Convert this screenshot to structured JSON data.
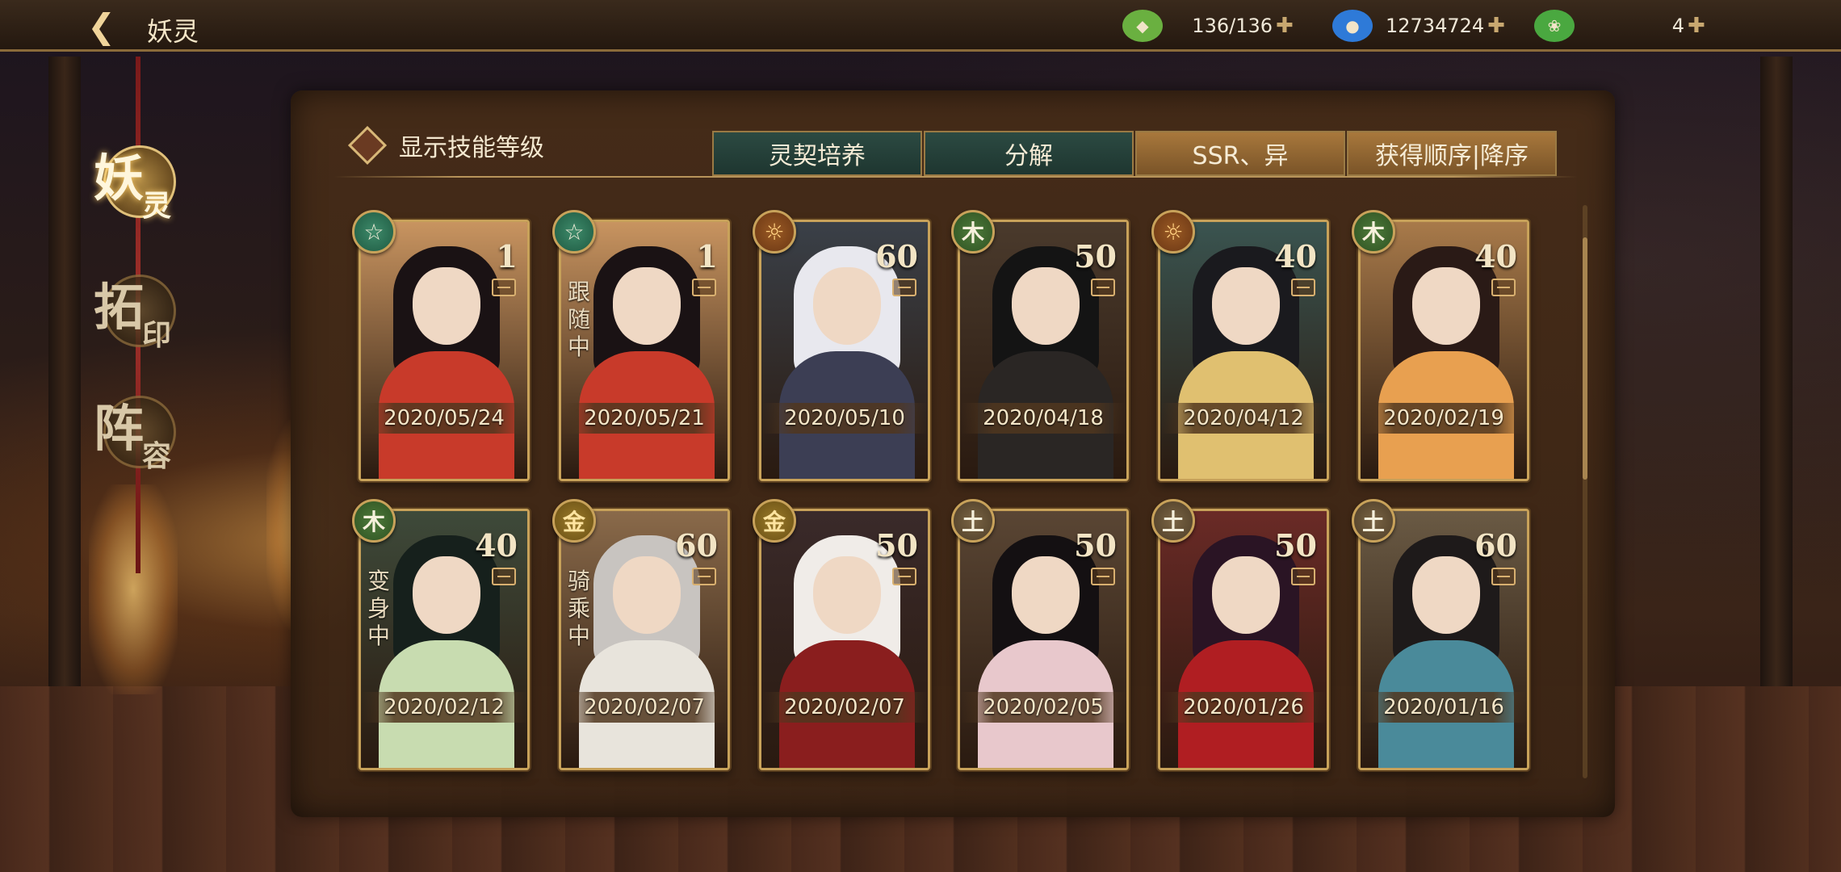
{
  "header": {
    "back_icon": "back-arrow-icon",
    "title": "妖灵",
    "resources": [
      {
        "name": "stamina",
        "icon": "jade-leaf-icon",
        "value": "136/136",
        "color": "#7fc04a"
      },
      {
        "name": "gold",
        "icon": "blue-gourd-icon",
        "value": "12734724",
        "color": "#3a8ae0"
      },
      {
        "name": "gem",
        "icon": "green-jade-coin-icon",
        "value": "4",
        "color": "#5ab04a"
      }
    ]
  },
  "sidebar": {
    "items": [
      {
        "big": "妖",
        "small": "灵",
        "active": true
      },
      {
        "big": "拓",
        "small": "印",
        "active": false
      },
      {
        "big": "阵",
        "small": "容",
        "active": false
      }
    ]
  },
  "toolbar": {
    "toggle_label": "显示技能等级",
    "tabs": [
      {
        "label": "灵契培养",
        "style": "teal"
      },
      {
        "label": "分解",
        "style": "teal"
      },
      {
        "label": "SSR、异",
        "style": "gold"
      },
      {
        "label": "获得顺序|降序",
        "style": "gold"
      }
    ]
  },
  "cards": [
    {
      "date": "2020/05/24",
      "level": "1",
      "element": "star",
      "status": "",
      "bg": "#c89460",
      "hair": "#1a1214",
      "outfit": "#c83a2a"
    },
    {
      "date": "2020/05/21",
      "level": "1",
      "element": "star",
      "status": "跟随中",
      "bg": "#c89460",
      "hair": "#1a1214",
      "outfit": "#c83a2a"
    },
    {
      "date": "2020/05/10",
      "level": "60",
      "element": "sun",
      "status": "",
      "bg": "#3a4048",
      "hair": "#e8e8ee",
      "outfit": "#3c3e54"
    },
    {
      "date": "2020/04/18",
      "level": "50",
      "element": "wood",
      "status": "",
      "bg": "#4a3a2c",
      "hair": "#141414",
      "outfit": "#2a2624"
    },
    {
      "date": "2020/04/12",
      "level": "40",
      "element": "sun",
      "status": "",
      "bg": "#3a5450",
      "hair": "#1a1a1e",
      "outfit": "#e0c070"
    },
    {
      "date": "2020/02/19",
      "level": "40",
      "element": "wood",
      "status": "",
      "bg": "#a87a4a",
      "hair": "#2a1a16",
      "outfit": "#e8a050"
    },
    {
      "date": "2020/02/12",
      "level": "40",
      "element": "wood",
      "status": "变身中",
      "bg": "#3e4a3a",
      "hair": "#16201c",
      "outfit": "#c8dcb0"
    },
    {
      "date": "2020/02/07",
      "level": "60",
      "element": "gold",
      "status": "骑乘中",
      "bg": "#8a6a4a",
      "hair": "#c8c4c0",
      "outfit": "#e8e4dc"
    },
    {
      "date": "2020/02/07",
      "level": "50",
      "element": "gold",
      "status": "",
      "bg": "#3a2a2a",
      "hair": "#f0ece8",
      "outfit": "#8a1e1e"
    },
    {
      "date": "2020/02/05",
      "level": "50",
      "element": "earth",
      "status": "",
      "bg": "#5a4634",
      "hair": "#141012",
      "outfit": "#e8c8cc"
    },
    {
      "date": "2020/01/26",
      "level": "50",
      "element": "earth",
      "status": "",
      "bg": "#6a2a26",
      "hair": "#2a1424",
      "outfit": "#b01e22"
    },
    {
      "date": "2020/01/16",
      "level": "60",
      "element": "earth",
      "status": "",
      "bg": "#6a5a44",
      "hair": "#1e1a1a",
      "outfit": "#4a8a9a"
    }
  ],
  "element_icons": {
    "star": {
      "glyph": "☆",
      "icon": "star-element-icon"
    },
    "sun": {
      "glyph": "☼",
      "icon": "sun-element-icon"
    },
    "wood": {
      "glyph": "木",
      "icon": "wood-element-icon"
    },
    "gold": {
      "glyph": "金",
      "icon": "gold-element-icon"
    },
    "earth": {
      "glyph": "土",
      "icon": "earth-element-icon"
    }
  }
}
